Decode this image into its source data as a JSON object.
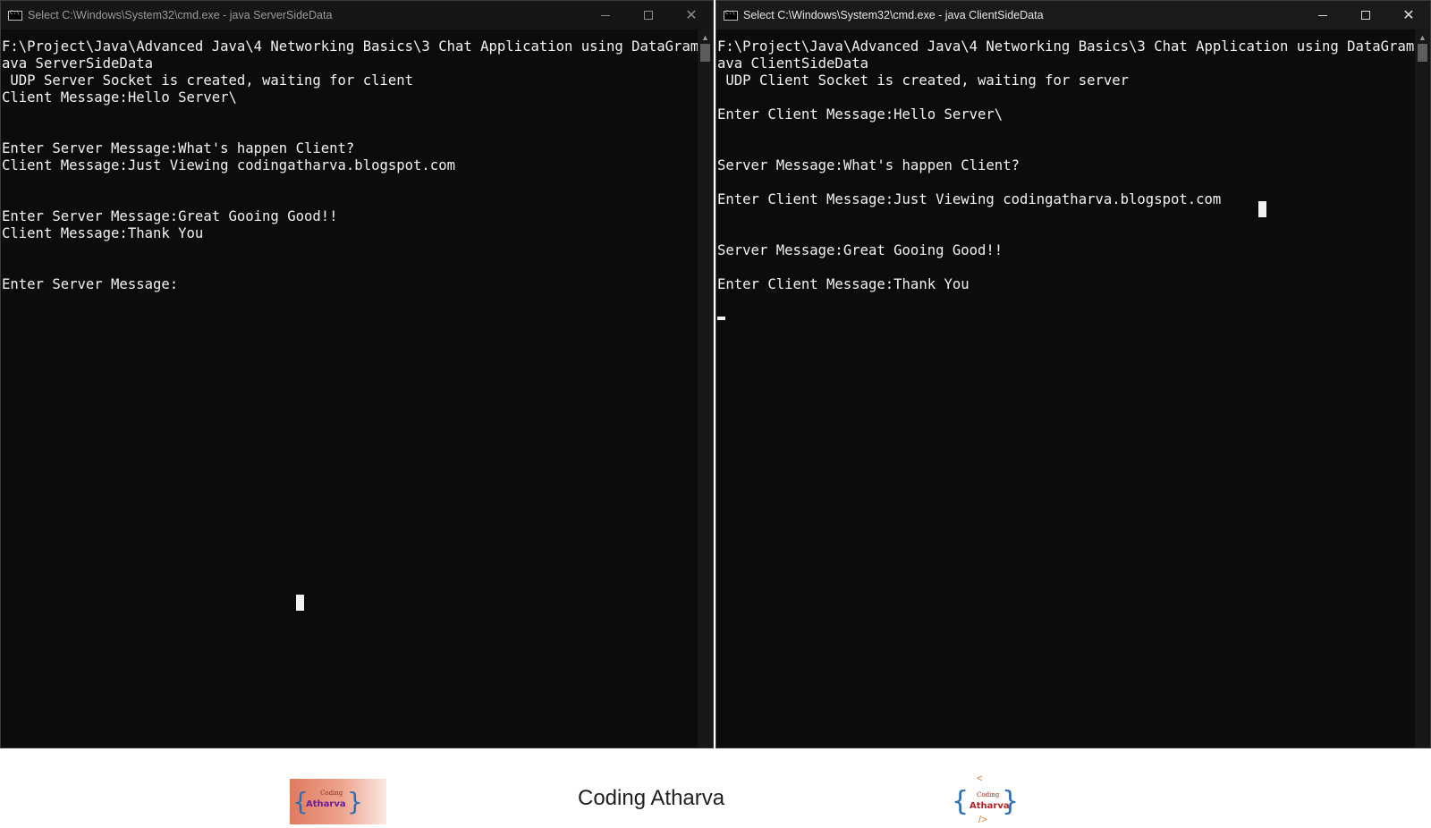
{
  "left_window": {
    "title": "Select C:\\Windows\\System32\\cmd.exe - java  ServerSideData",
    "console_lines": [
      "F:\\Project\\Java\\Advanced Java\\4 Networking Basics\\3 Chat Application using DataGram>j",
      "ava ServerSideData",
      " UDP Server Socket is created, waiting for client",
      "Client Message:Hello Server\\",
      "",
      "",
      "Enter Server Message:What's happen Client?",
      "Client Message:Just Viewing codingatharva.blogspot.com",
      "",
      "",
      "Enter Server Message:Great Gooing Good!!",
      "Client Message:Thank You",
      "",
      "",
      "Enter Server Message:"
    ]
  },
  "right_window": {
    "title": "Select C:\\Windows\\System32\\cmd.exe - java  ClientSideData",
    "console_lines": [
      "F:\\Project\\Java\\Advanced Java\\4 Networking Basics\\3 Chat Application using DataGram>j",
      "ava ClientSideData",
      " UDP Client Socket is created, waiting for server",
      "",
      "Enter Client Message:Hello Server\\",
      "",
      "",
      "Server Message:What's happen Client?",
      "",
      "Enter Client Message:Just Viewing codingatharva.blogspot.com",
      "",
      "",
      "Server Message:Great Gooing Good!!",
      "",
      "Enter Client Message:Thank You"
    ]
  },
  "window_controls": {
    "minimize": "—",
    "maximize": "☐",
    "close": "✕"
  },
  "footer": {
    "brand_name": "Coding Atharva",
    "logo_small_text": "Coding",
    "logo_big_text": "Atharva",
    "logo_brace_left": "{",
    "logo_brace_right": "}",
    "logo_lt": "<",
    "logo_gt": "/>"
  },
  "colors": {
    "console_bg": "#0c0c0c",
    "console_fg": "#f2f2f2",
    "brand_blue": "#2f6fb3",
    "brand_orange": "#e0742f"
  }
}
